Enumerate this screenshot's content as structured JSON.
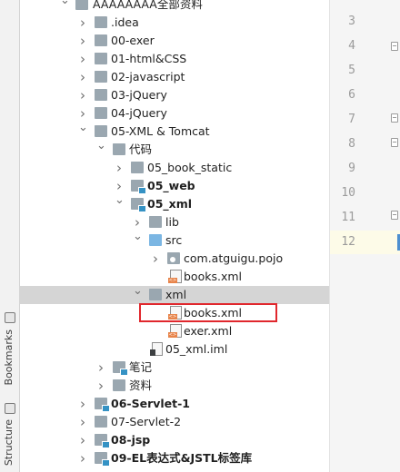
{
  "tool_strip": {
    "bookmarks_label": "Bookmarks",
    "structure_label": "Structure"
  },
  "tree": [
    {
      "label": "AAAAAAAA全部资料",
      "icon": "folder",
      "state": "expanded",
      "bold": false
    },
    {
      "label": ".idea",
      "icon": "folder",
      "state": "collapsed",
      "bold": false
    },
    {
      "label": "00-exer",
      "icon": "folder",
      "state": "collapsed",
      "bold": false
    },
    {
      "label": "01-html&CSS",
      "icon": "folder",
      "state": "collapsed",
      "bold": false
    },
    {
      "label": "02-javascript",
      "icon": "folder",
      "state": "collapsed",
      "bold": false
    },
    {
      "label": "03-jQuery",
      "icon": "folder",
      "state": "collapsed",
      "bold": false
    },
    {
      "label": "04-jQuery",
      "icon": "folder",
      "state": "collapsed",
      "bold": false
    },
    {
      "label": "05-XML & Tomcat",
      "icon": "folder",
      "state": "expanded",
      "bold": false
    },
    {
      "label": "代码",
      "icon": "folder",
      "state": "expanded",
      "bold": false
    },
    {
      "label": "05_book_static",
      "icon": "folder",
      "state": "collapsed",
      "bold": false
    },
    {
      "label": "05_web",
      "icon": "module-folder",
      "state": "collapsed",
      "bold": true
    },
    {
      "label": "05_xml",
      "icon": "module-folder",
      "state": "expanded",
      "bold": true
    },
    {
      "label": "lib",
      "icon": "folder",
      "state": "collapsed",
      "bold": false
    },
    {
      "label": "src",
      "icon": "source-folder",
      "state": "expanded",
      "bold": false
    },
    {
      "label": "com.atguigu.pojo",
      "icon": "package",
      "state": "collapsed",
      "bold": false
    },
    {
      "label": "books.xml",
      "icon": "xml-file",
      "state": "leaf",
      "bold": false
    },
    {
      "label": "xml",
      "icon": "folder",
      "state": "expanded",
      "bold": false,
      "selected": true
    },
    {
      "label": "books.xml",
      "icon": "xml-file",
      "state": "leaf",
      "bold": false,
      "highlighted": true
    },
    {
      "label": "exer.xml",
      "icon": "xml-file",
      "state": "leaf",
      "bold": false
    },
    {
      "label": "05_xml.iml",
      "icon": "iml-file",
      "state": "leaf",
      "bold": false
    },
    {
      "label": "笔记",
      "icon": "module-folder",
      "state": "collapsed",
      "bold": false
    },
    {
      "label": "资料",
      "icon": "folder",
      "state": "collapsed",
      "bold": false
    },
    {
      "label": "06-Servlet-1",
      "icon": "module-folder",
      "state": "collapsed",
      "bold": true
    },
    {
      "label": "07-Servlet-2",
      "icon": "folder",
      "state": "collapsed",
      "bold": false
    },
    {
      "label": "08-jsp",
      "icon": "module-folder",
      "state": "collapsed",
      "bold": true
    },
    {
      "label": "09-EL表达式&JSTL标签库",
      "icon": "module-folder",
      "state": "collapsed",
      "bold": true
    }
  ],
  "gutter": {
    "line_numbers": [
      "3",
      "4",
      "5",
      "6",
      "7",
      "8",
      "9",
      "10",
      "11",
      "12"
    ],
    "current_line": "12"
  },
  "colors": {
    "highlight_border": "#e0272d",
    "selected_row": "#d5d5d5",
    "folder": "#9aa7b0",
    "source_folder": "#7bb6e3",
    "module_marker": "#3592c4"
  }
}
